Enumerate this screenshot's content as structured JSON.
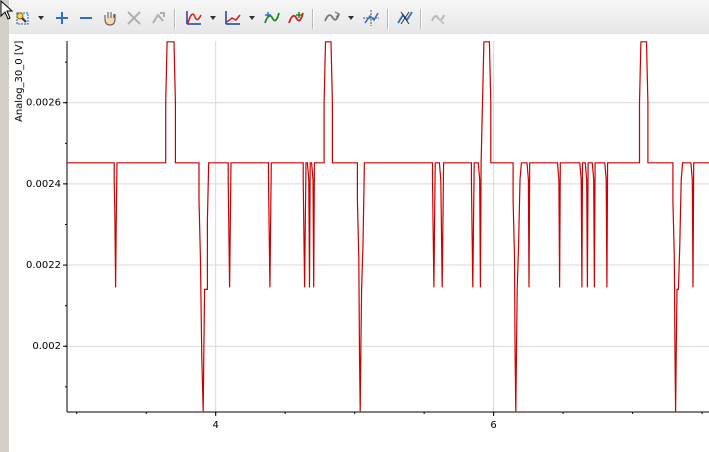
{
  "toolbar": {
    "buttons": [
      {
        "name": "zoom-select-icon",
        "enabled": true,
        "dropdown": true
      },
      {
        "name": "zoom-in-icon",
        "enabled": true
      },
      {
        "name": "zoom-out-icon",
        "enabled": true
      },
      {
        "name": "pan-hand-icon",
        "enabled": true
      },
      {
        "name": "cursor-measure-icon",
        "enabled": false
      },
      {
        "name": "cursor-pick-icon",
        "enabled": false
      },
      {
        "name": "curve-style-icon",
        "enabled": true,
        "dropdown": true
      },
      {
        "name": "axis-style-icon",
        "enabled": true,
        "dropdown": true
      },
      {
        "name": "autoscale-y-icon",
        "enabled": true
      },
      {
        "name": "autoscale-x-icon",
        "enabled": true
      },
      {
        "name": "fit-curve-icon",
        "enabled": true,
        "dropdown": true
      },
      {
        "name": "crosshair-icon",
        "enabled": true
      },
      {
        "name": "mark-points-icon",
        "enabled": true
      },
      {
        "name": "hide-points-icon",
        "enabled": false
      }
    ]
  },
  "chart_data": {
    "type": "line",
    "ylabel": "Analog_30_0 [V]",
    "xlabel": "",
    "title": "",
    "xlim": [
      2.93,
      7.55
    ],
    "ylim": [
      0.001838,
      0.002752
    ],
    "xticks": [
      4,
      6
    ],
    "xtick_labels": [
      "4",
      "6"
    ],
    "yticks": [
      0.002,
      0.0022,
      0.0024,
      0.0026
    ],
    "ytick_labels": [
      "0.002",
      "0.0022",
      "0.0024",
      "0.0026"
    ],
    "grid": true,
    "line_color": "#cc0000",
    "levels": {
      "high": 0.002452,
      "peak": 0.00275,
      "low": 0.002145,
      "mid_low": 0.00214,
      "floor": 0.00184
    },
    "series": [
      {
        "points": [
          [
            2.93,
            0.002452
          ],
          [
            3.27,
            0.002452
          ],
          [
            3.27,
            0.00241
          ],
          [
            3.275,
            0.00232
          ],
          [
            3.28,
            0.002145
          ],
          [
            3.285,
            0.00232
          ],
          [
            3.29,
            0.002452
          ],
          [
            3.64,
            0.002452
          ],
          [
            3.64,
            0.0026
          ],
          [
            3.65,
            0.00275
          ],
          [
            3.7,
            0.00275
          ],
          [
            3.71,
            0.0026
          ],
          [
            3.71,
            0.002452
          ],
          [
            3.88,
            0.002452
          ],
          [
            3.88,
            0.00236
          ],
          [
            3.89,
            0.00222
          ],
          [
            3.9,
            0.00197
          ],
          [
            3.91,
            0.00184
          ],
          [
            3.915,
            0.002
          ],
          [
            3.92,
            0.00214
          ],
          [
            3.94,
            0.00214
          ],
          [
            3.94,
            0.00231
          ],
          [
            3.95,
            0.002452
          ],
          [
            4.09,
            0.002452
          ],
          [
            4.09,
            0.00241
          ],
          [
            4.1,
            0.002145
          ],
          [
            4.11,
            0.002452
          ],
          [
            4.38,
            0.002452
          ],
          [
            4.38,
            0.00241
          ],
          [
            4.39,
            0.002145
          ],
          [
            4.4,
            0.002452
          ],
          [
            4.63,
            0.002452
          ],
          [
            4.63,
            0.00241
          ],
          [
            4.64,
            0.002145
          ],
          [
            4.65,
            0.002452
          ],
          [
            4.66,
            0.002452
          ],
          [
            4.67,
            0.00241
          ],
          [
            4.675,
            0.002145
          ],
          [
            4.68,
            0.002452
          ],
          [
            4.69,
            0.002452
          ],
          [
            4.7,
            0.00241
          ],
          [
            4.705,
            0.002145
          ],
          [
            4.71,
            0.002452
          ],
          [
            4.78,
            0.002452
          ],
          [
            4.78,
            0.0026
          ],
          [
            4.79,
            0.00275
          ],
          [
            4.83,
            0.00275
          ],
          [
            4.84,
            0.0026
          ],
          [
            4.84,
            0.002452
          ],
          [
            5.02,
            0.002452
          ],
          [
            5.02,
            0.00236
          ],
          [
            5.03,
            0.00222
          ],
          [
            5.035,
            0.00198
          ],
          [
            5.04,
            0.00184
          ],
          [
            5.045,
            0.002
          ],
          [
            5.05,
            0.00214
          ],
          [
            5.06,
            0.00225
          ],
          [
            5.07,
            0.002452
          ],
          [
            5.56,
            0.002452
          ],
          [
            5.56,
            0.00241
          ],
          [
            5.57,
            0.002145
          ],
          [
            5.58,
            0.002452
          ],
          [
            5.61,
            0.002452
          ],
          [
            5.62,
            0.00241
          ],
          [
            5.63,
            0.002145
          ],
          [
            5.64,
            0.002452
          ],
          [
            5.84,
            0.002452
          ],
          [
            5.84,
            0.00241
          ],
          [
            5.85,
            0.002145
          ],
          [
            5.86,
            0.002452
          ],
          [
            5.89,
            0.002452
          ],
          [
            5.9,
            0.00241
          ],
          [
            5.905,
            0.002145
          ],
          [
            5.91,
            0.002452
          ],
          [
            5.91,
            0.002452
          ],
          [
            5.92,
            0.0026
          ],
          [
            5.93,
            0.00275
          ],
          [
            5.97,
            0.00275
          ],
          [
            5.98,
            0.0026
          ],
          [
            5.98,
            0.002452
          ],
          [
            6.14,
            0.002452
          ],
          [
            6.14,
            0.00236
          ],
          [
            6.15,
            0.00222
          ],
          [
            6.155,
            0.00198
          ],
          [
            6.16,
            0.00184
          ],
          [
            6.17,
            0.00214
          ],
          [
            6.18,
            0.00225
          ],
          [
            6.19,
            0.00241
          ],
          [
            6.2,
            0.002452
          ],
          [
            6.24,
            0.002452
          ],
          [
            6.25,
            0.00241
          ],
          [
            6.255,
            0.002145
          ],
          [
            6.26,
            0.002452
          ],
          [
            6.46,
            0.002452
          ],
          [
            6.47,
            0.00241
          ],
          [
            6.475,
            0.002145
          ],
          [
            6.48,
            0.002452
          ],
          [
            6.62,
            0.002452
          ],
          [
            6.63,
            0.00241
          ],
          [
            6.635,
            0.002145
          ],
          [
            6.64,
            0.002452
          ],
          [
            6.66,
            0.002452
          ],
          [
            6.67,
            0.00241
          ],
          [
            6.675,
            0.002145
          ],
          [
            6.68,
            0.002452
          ],
          [
            6.71,
            0.002452
          ],
          [
            6.72,
            0.00241
          ],
          [
            6.725,
            0.002145
          ],
          [
            6.73,
            0.002452
          ],
          [
            6.8,
            0.002452
          ],
          [
            6.81,
            0.00241
          ],
          [
            6.815,
            0.002145
          ],
          [
            6.82,
            0.002452
          ],
          [
            7.05,
            0.002452
          ],
          [
            7.05,
            0.0026
          ],
          [
            7.06,
            0.00275
          ],
          [
            7.1,
            0.00275
          ],
          [
            7.11,
            0.0026
          ],
          [
            7.11,
            0.002452
          ],
          [
            7.29,
            0.002452
          ],
          [
            7.29,
            0.00236
          ],
          [
            7.3,
            0.00222
          ],
          [
            7.305,
            0.00198
          ],
          [
            7.31,
            0.00184
          ],
          [
            7.315,
            0.002
          ],
          [
            7.32,
            0.00214
          ],
          [
            7.33,
            0.00214
          ],
          [
            7.34,
            0.00225
          ],
          [
            7.35,
            0.00241
          ],
          [
            7.36,
            0.002452
          ],
          [
            7.42,
            0.002452
          ],
          [
            7.43,
            0.00241
          ],
          [
            7.435,
            0.002145
          ],
          [
            7.44,
            0.002452
          ],
          [
            7.55,
            0.002452
          ]
        ]
      }
    ]
  }
}
